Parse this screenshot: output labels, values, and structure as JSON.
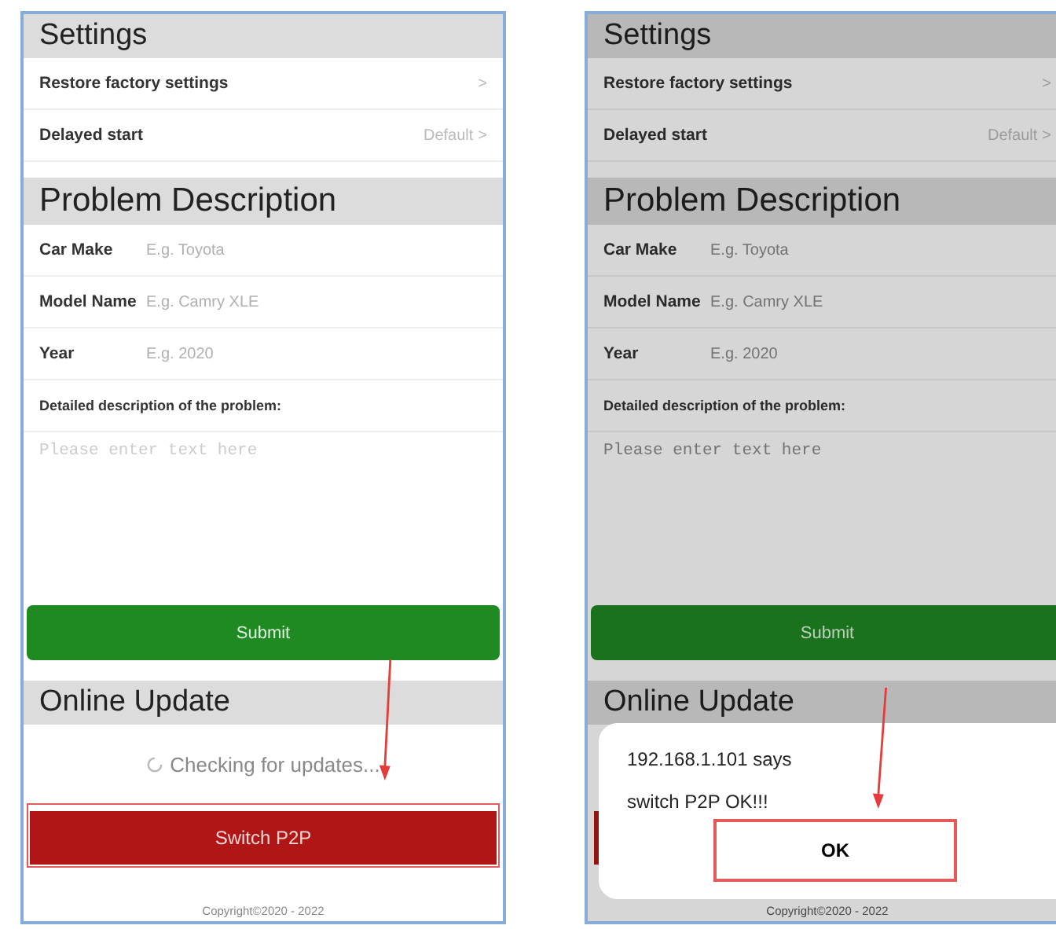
{
  "screens": [
    {
      "dimmed": false,
      "settings": {
        "title": "Settings",
        "items": [
          {
            "label": "Restore factory settings",
            "chevron": ">"
          },
          {
            "label": "Delayed start",
            "value": "Default",
            "chevron": ">"
          }
        ]
      },
      "problem": {
        "title": "Problem Description",
        "fields": [
          {
            "label": "Car Make",
            "placeholder": "E.g. Toyota"
          },
          {
            "label": "Model Name",
            "placeholder": "E.g. Camry XLE"
          },
          {
            "label": "Year",
            "placeholder": "E.g. 2020"
          }
        ],
        "description_label": "Detailed description of the problem:",
        "description_placeholder": "Please enter text here"
      },
      "submit": "Submit",
      "update": {
        "title": "Online Update",
        "status": "Checking for updates...",
        "button": {
          "label": "Switch P2P",
          "highlighted": true
        }
      },
      "copyright": "Copyright©2020 - 2022"
    },
    {
      "dimmed": true,
      "settings": {
        "title": "Settings",
        "items": [
          {
            "label": "Restore factory settings",
            "chevron": ">"
          },
          {
            "label": "Delayed start",
            "value": "Default",
            "chevron": ">"
          }
        ]
      },
      "problem": {
        "title": "Problem Description",
        "fields": [
          {
            "label": "Car Make",
            "placeholder": "E.g. Toyota"
          },
          {
            "label": "Model Name",
            "placeholder": "E.g. Camry XLE"
          },
          {
            "label": "Year",
            "placeholder": "E.g. 2020"
          }
        ],
        "description_label": "Detailed description of the problem:",
        "description_placeholder": "Please enter text here"
      },
      "submit": "Submit",
      "update": {
        "title": "Online Update",
        "button": {
          "highlighted": false
        }
      },
      "copyright": "Copyright©2020 - 2022",
      "dialog": {
        "origin": "192.168.1.101 says",
        "message": "switch P2P OK!!!",
        "button": {
          "label": "OK",
          "highlighted": true
        }
      }
    }
  ]
}
